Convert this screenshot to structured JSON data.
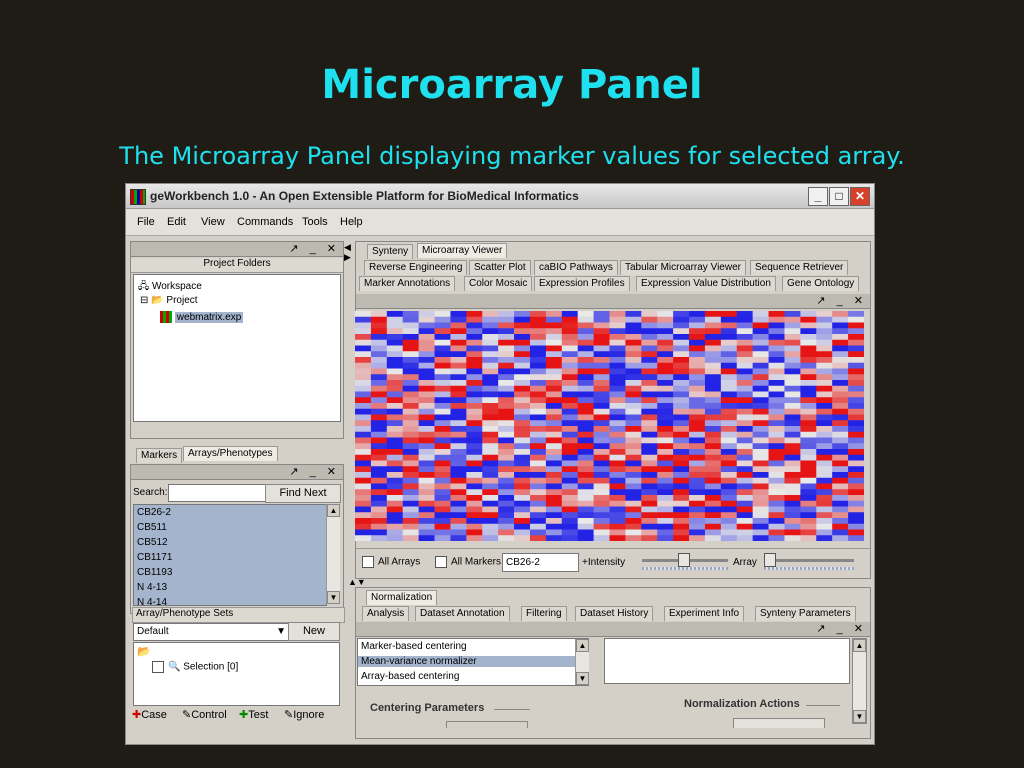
{
  "slide": {
    "title": "Microarray Panel",
    "subtitle": "The Microarray Panel displaying marker values for selected array."
  },
  "window": {
    "title": "geWorkbench 1.0 - An Open Extensible Platform for BioMedical Informatics",
    "buttons": [
      "_",
      "□",
      "✕"
    ]
  },
  "menu": [
    "File",
    "Edit",
    "View",
    "Commands",
    "Tools",
    "Help"
  ],
  "project": {
    "header": "Project Folders",
    "workspace": "Workspace",
    "project": "Project",
    "file": "webmatrix.exp"
  },
  "left_tabs": [
    "Markers",
    "Arrays/Phenotypes"
  ],
  "search": {
    "label": "Search:",
    "value": "",
    "button": "Find Next"
  },
  "arrays": [
    "CB26-2",
    "CB511",
    "CB512",
    "CB1171",
    "CB1193",
    "N 4-13",
    "N 4-14"
  ],
  "sets": {
    "header": "Array/Phenotype Sets",
    "selected": "Default",
    "new_button": "New",
    "selection": "Selection [0]"
  },
  "bottom_legend": [
    "Case",
    "Control",
    "Test",
    "Ignore"
  ],
  "viewer_tabs_row1": [
    "Synteny",
    "Microarray Viewer"
  ],
  "viewer_tabs_row2": [
    "Reverse Engineering",
    "Scatter Plot",
    "caBIO Pathways",
    "Tabular Microarray Viewer",
    "Sequence Retriever"
  ],
  "viewer_tabs_row3": [
    "Marker Annotations",
    "Color Mosaic",
    "Expression Profiles",
    "Expression Value Distribution",
    "Gene Ontology"
  ],
  "heatmap": {
    "rows": 40,
    "cols": 32
  },
  "heat_controls": {
    "all_arrays": "All Arrays",
    "all_markers": "All Markers",
    "array_value": "CB26-2",
    "intensity": "+Intensity",
    "array_label": "Array"
  },
  "analysis_tabs_row1": [
    "Normalization"
  ],
  "analysis_tabs_row2": [
    "Analysis",
    "Dataset Annotation",
    "Filtering",
    "Dataset History",
    "Experiment Info",
    "Synteny Parameters"
  ],
  "normalizers": [
    "Marker-based centering",
    "Mean-variance normalizer",
    "Array-based centering"
  ],
  "centering_label": "Centering Parameters",
  "norm_actions": "Normalization Actions",
  "colors": {
    "title": "#1ee0ee",
    "background": "#1e1c14",
    "red": "#e01818",
    "blue": "#1a1ad8"
  }
}
